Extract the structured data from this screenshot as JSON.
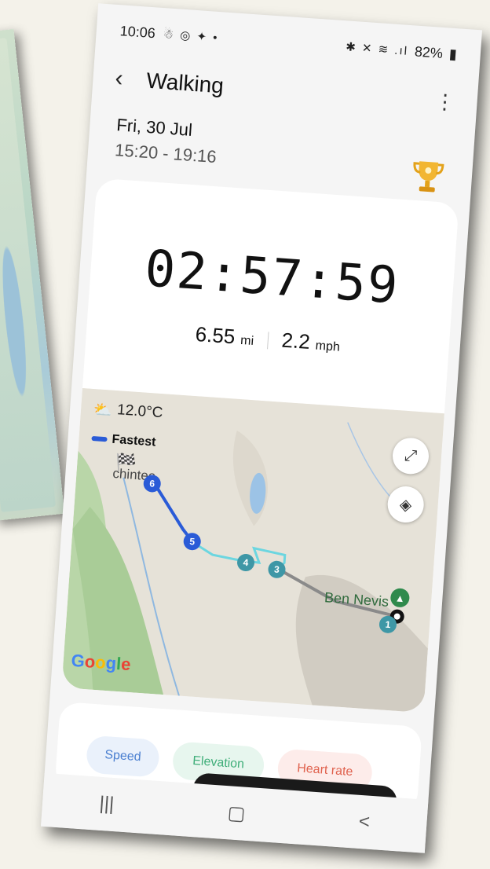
{
  "status": {
    "time": "10:06",
    "notif_icons": "☃ ◎ ✦ •",
    "sys_icons": "✱ ✕ ≋ .ıl",
    "battery": "82%"
  },
  "header": {
    "title": "Walking"
  },
  "session": {
    "date": "Fri, 30 Jul",
    "time_range": "15:20 - 19:16"
  },
  "summary": {
    "duration": "02:57:59",
    "distance_value": "6.55",
    "distance_unit": "mi",
    "speed_value": "2.2",
    "speed_unit": "mph"
  },
  "map": {
    "temperature": "12.0°C",
    "legend_fastest": "Fastest",
    "start_label": "chintee",
    "peak_label": "Ben Nevis",
    "brand": "Google",
    "markers": [
      "1",
      "3",
      "4",
      "5",
      "6"
    ]
  },
  "tabs": [
    {
      "label": "Speed",
      "color": "#4a7fd0",
      "bg": "#eaf1fb"
    },
    {
      "label": "Elevation",
      "color": "#3fae79",
      "bg": "#e7f6ee"
    },
    {
      "label": "Heart rate",
      "color": "#e0624e",
      "bg": "#fdecea"
    }
  ],
  "colors": {
    "fastest_route": "#2a5bd7",
    "route_cyan": "#6cd6e0",
    "route_gray": "#8a8a8a",
    "marker_teal": "#3e97a6"
  }
}
